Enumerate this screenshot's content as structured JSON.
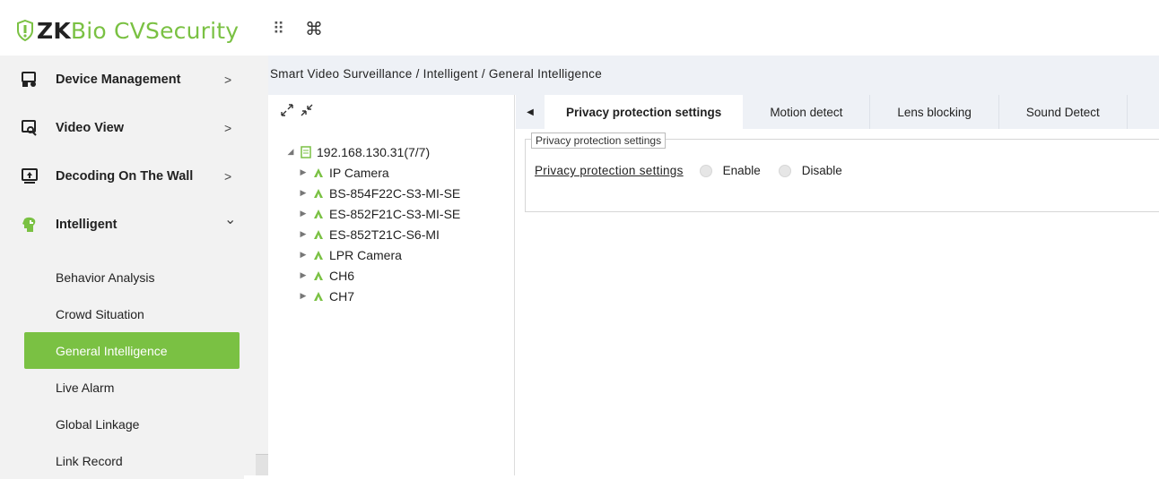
{
  "header": {
    "logo_zk": "ZK",
    "logo_rest": "Bio CVSecurity",
    "grid_icon": "⠿",
    "cmd_icon": "⌘"
  },
  "sidebar": {
    "items": [
      {
        "label": "Device Management",
        "icon": "device-icon",
        "arrow": ">"
      },
      {
        "label": "Video View",
        "icon": "video-view-icon",
        "arrow": ">"
      },
      {
        "label": "Decoding On The Wall",
        "icon": "decoding-icon",
        "arrow": ">"
      },
      {
        "label": "Intelligent",
        "icon": "intelligent-icon",
        "arrow": "⌄"
      }
    ],
    "subitems": [
      {
        "label": "Behavior Analysis"
      },
      {
        "label": "Crowd Situation"
      },
      {
        "label": "General Intelligence",
        "active": true
      },
      {
        "label": "Live Alarm"
      },
      {
        "label": "Global Linkage"
      },
      {
        "label": "Link Record"
      }
    ]
  },
  "breadcrumb": "Smart Video Surveillance / Intelligent / General Intelligence",
  "tree": {
    "root": "192.168.130.31(7/7)",
    "children": [
      "IP Camera",
      "BS-854F22C-S3-MI-SE",
      "ES-852F21C-S3-MI-SE",
      "ES-852T21C-S6-MI",
      "LPR Camera",
      "CH6",
      "CH7"
    ]
  },
  "tabs": [
    "Privacy protection settings",
    "Motion detect",
    "Lens blocking",
    "Sound Detect"
  ],
  "section": {
    "legend": "Privacy protection settings",
    "label": "Privacy protection settings",
    "enable": "Enable",
    "disable": "Disable"
  },
  "colors": {
    "accent": "#7ac143",
    "breadcrumb_bg": "#eef1f6",
    "sidebar_bg": "#f2f2f2"
  }
}
